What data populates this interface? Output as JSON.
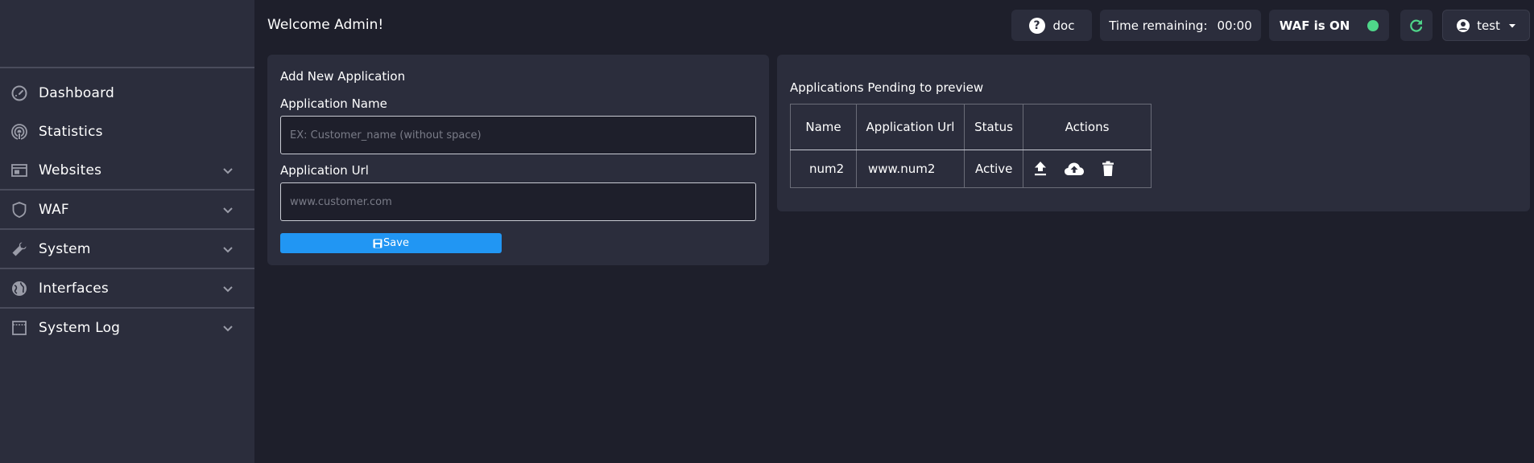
{
  "header": {
    "welcome": "Welcome Admin!",
    "doc_label": "doc",
    "time_label": "Time remaining:",
    "time_value": "00:00",
    "waf_status": "WAF is ON",
    "waf_status_color": "#4fd68a",
    "user_name": "test"
  },
  "sidebar": {
    "items": [
      {
        "label": "Dashboard",
        "icon": "speedometer-icon",
        "expandable": false
      },
      {
        "label": "Statistics",
        "icon": "broadcast-icon",
        "expandable": false
      },
      {
        "label": "Websites",
        "icon": "browser-window-icon",
        "expandable": true
      },
      {
        "label": "WAF",
        "icon": "shield-icon",
        "expandable": true
      },
      {
        "label": "System",
        "icon": "wrench-icon",
        "expandable": true
      },
      {
        "label": "Interfaces",
        "icon": "globe-icon",
        "expandable": true
      },
      {
        "label": "System Log",
        "icon": "window-icon",
        "expandable": true
      }
    ]
  },
  "add_form": {
    "title": "Add New Application",
    "name_label": "Application Name",
    "name_placeholder": "EX: Customer_name (without space)",
    "url_label": "Application Url",
    "url_placeholder": "www.customer.com",
    "save_label": "Save"
  },
  "pending": {
    "title": "Applications Pending to preview",
    "columns": [
      "Name",
      "Application Url",
      "Status",
      "Actions"
    ],
    "rows": [
      {
        "name": "num2",
        "url": "www.num2",
        "status": "Active",
        "actions": [
          "upload-icon",
          "cloud-upload-icon",
          "trash-icon"
        ]
      }
    ]
  },
  "colors": {
    "background": "#1e1f2b",
    "panel": "#2b2d3c",
    "accent": "#2196f3",
    "refresh": "#4fd68a"
  }
}
